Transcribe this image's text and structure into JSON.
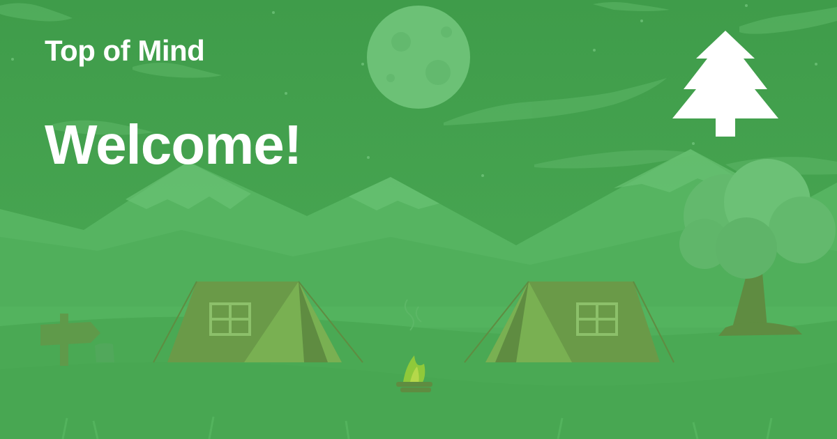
{
  "brand": {
    "name": "Top of Mind"
  },
  "hero": {
    "headline": "Welcome!"
  },
  "logo": {
    "icon": "pine-tree-icon"
  },
  "colors": {
    "background": "#45a24f",
    "text": "#ffffff",
    "moon": "#6cc176",
    "mountain": "#5ab865",
    "tent": "#6a9a48"
  }
}
